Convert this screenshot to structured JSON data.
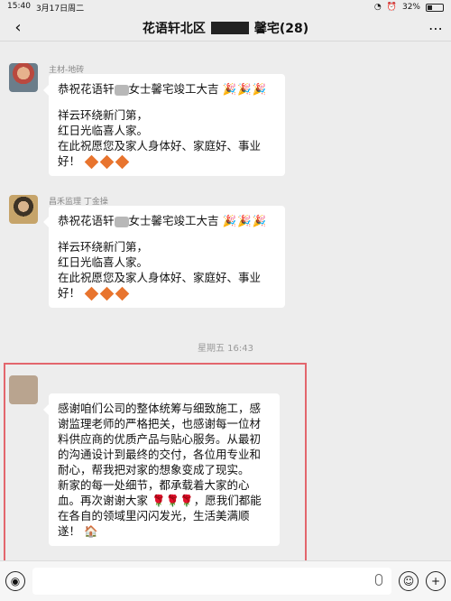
{
  "status_bar": {
    "time": "15:40",
    "date": "3月17日周二",
    "wifi": "wifi-icon",
    "alarm": "alarm-icon",
    "battery": "32%"
  },
  "header": {
    "title_prefix": "花语轩北区",
    "title_suffix": "馨宅(28)",
    "back_icon": "chevron-left-icon",
    "more_icon": "more-icon"
  },
  "messages": [
    {
      "sender": "主材-地砖",
      "lines": [
        "恭祝花语轩",
        "女士馨宅竣工大吉",
        "祥云环绕新门第，",
        "红日光临喜人家。",
        "在此祝愿您及家人身体好、家庭好、事业",
        "好！"
      ]
    },
    {
      "sender": "昌禾监理 丁金操",
      "lines": [
        "恭祝花语轩",
        "女士馨宅竣工大吉",
        "祥云环绕新门第，",
        "红日光临喜人家。",
        "在此祝愿您及家人身体好、家庭好、事业",
        "好！"
      ]
    }
  ],
  "timestamp": "星期五 16:43",
  "highlight_message": {
    "lines": [
      "感谢咱们公司的整体统筹与细致施工，感",
      "谢监理老师的严格把关，也感谢每一位材",
      "料供应商的优质产品与贴心服务。从最初",
      "的沟通设计到最终的交付，各位用专业和",
      "耐心，帮我把对家的想象变成了现实。",
      "新家的每一处细节，都承载着大家的心",
      "血。再次谢谢大家",
      "，愿我们都能",
      "在各自的领域里闪闪发光，生活美满顺",
      "遂！"
    ]
  },
  "input_bar": {
    "voice_icon": "voice-icon",
    "emoji_icon": "emoji-icon",
    "plus_icon": "plus-icon",
    "mic_icon": "mic-icon"
  }
}
